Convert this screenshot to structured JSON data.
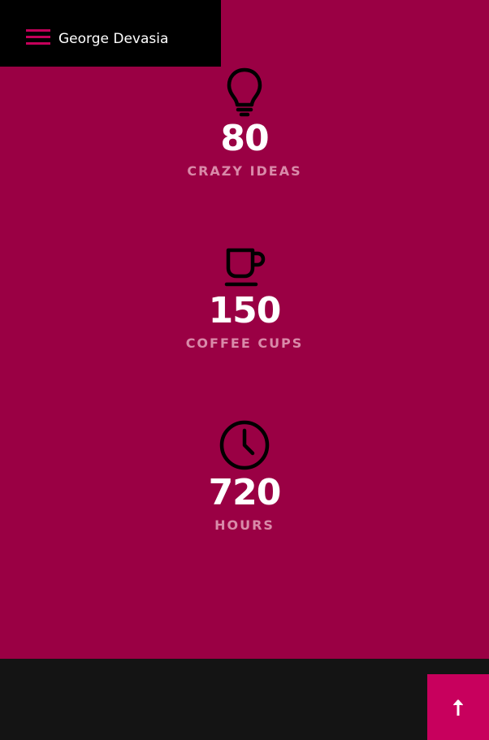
{
  "header": {
    "menu_icon": "hamburger-menu-icon",
    "site_title": "George Devasia"
  },
  "stats": [
    {
      "icon": "lightbulb-icon",
      "value": "80",
      "label": "CRAZY IDEAS"
    },
    {
      "icon": "coffee-cup-icon",
      "value": "150",
      "label": "COFFEE CUPS"
    },
    {
      "icon": "clock-icon",
      "value": "720",
      "label": "HOURS"
    }
  ],
  "back_to_top": {
    "icon": "arrow-up-icon"
  },
  "colors": {
    "section_background": "#9a0044",
    "header_background": "#000000",
    "footer_background": "#141414",
    "accent": "#c8005d",
    "label_text": "#d98aa9"
  }
}
